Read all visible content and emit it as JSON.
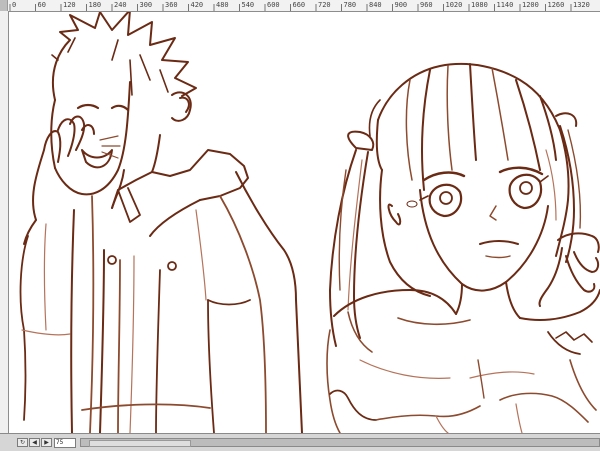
{
  "ruler": {
    "horizontal_labels": [
      "0",
      "60",
      "120",
      "180",
      "240",
      "300",
      "360",
      "420",
      "480",
      "540",
      "600",
      "660",
      "720",
      "780",
      "840",
      "900",
      "960",
      "1020",
      "1080",
      "1140",
      "1200",
      "1260",
      "1320"
    ]
  },
  "statusbar": {
    "nav_prev_icon": "◀",
    "nav_next_icon": "▶",
    "rotate_icon": "↻",
    "zoom_value": "75"
  },
  "colors": {
    "line_dark": "#6a2a14",
    "line_mid": "#8c4a2e",
    "line_light": "#b5735a"
  }
}
